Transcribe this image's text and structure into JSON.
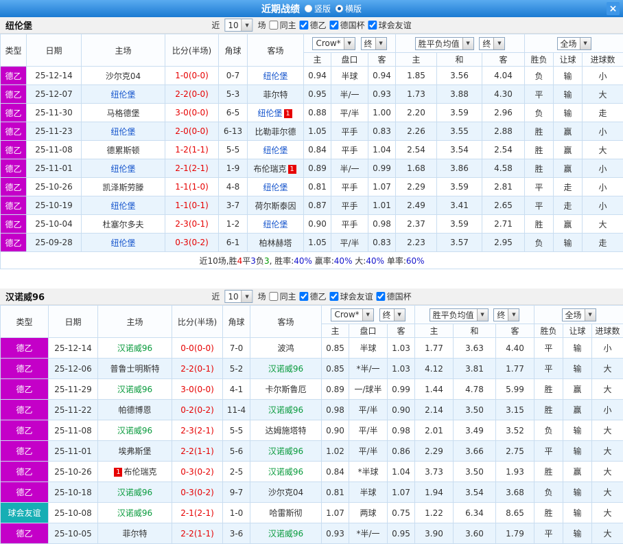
{
  "titlebar": {
    "title": "近期战绩",
    "radio_vertical": "竖版",
    "radio_horizontal": "横版",
    "selected_layout": "横版",
    "close_icon": "×"
  },
  "sections": [
    {
      "team": "纽伦堡",
      "team_color": "#1353cc",
      "filters": {
        "near_label": "近",
        "games_select": "10",
        "games_label": "场",
        "checkboxes": [
          {
            "label": "同主",
            "checked": false
          },
          {
            "label": "德乙",
            "checked": true
          },
          {
            "label": "德国杯",
            "checked": true
          },
          {
            "label": "球会友谊",
            "checked": true
          }
        ]
      },
      "header": {
        "type": "类型",
        "date": "日期",
        "home": "主场",
        "score": "比分(半场)",
        "corner": "角球",
        "away": "客场",
        "odds_company": "Crow*",
        "odds_stage": "终",
        "wdl_label": "胜平负均值",
        "wdl_stage": "终",
        "scope": "全场",
        "sub": [
          "主",
          "盘口",
          "客",
          "主",
          "和",
          "客",
          "胜负",
          "让球",
          "进球数"
        ]
      },
      "rows": [
        {
          "league": "德乙",
          "league_class": "de2",
          "date": "25-12-14",
          "home": "沙尔克04",
          "home_focus": false,
          "score": "1-0(0-0)",
          "corner": "0-7",
          "away": "纽伦堡",
          "away_focus": true,
          "asia": [
            "0.94",
            "半球",
            "0.94"
          ],
          "europe": [
            "1.85",
            "3.56",
            "4.04"
          ],
          "result": "负",
          "handicap": "输",
          "goals": "小"
        },
        {
          "league": "德乙",
          "league_class": "de2",
          "date": "25-12-07",
          "home": "纽伦堡",
          "home_focus": true,
          "score": "2-2(0-0)",
          "corner": "5-3",
          "away": "菲尔特",
          "away_focus": false,
          "asia": [
            "0.95",
            "半/一",
            "0.93"
          ],
          "europe": [
            "1.73",
            "3.88",
            "4.30"
          ],
          "result": "平",
          "handicap": "输",
          "goals": "大"
        },
        {
          "league": "德乙",
          "league_class": "de2",
          "date": "25-11-30",
          "home": "马格德堡",
          "home_focus": false,
          "score": "3-0(0-0)",
          "corner": "6-5",
          "away": "纽伦堡",
          "away_focus": true,
          "away_badge": "1",
          "asia": [
            "0.88",
            "平/半",
            "1.00"
          ],
          "europe": [
            "2.20",
            "3.59",
            "2.96"
          ],
          "result": "负",
          "handicap": "输",
          "goals": "走"
        },
        {
          "league": "德乙",
          "league_class": "de2",
          "date": "25-11-23",
          "home": "纽伦堡",
          "home_focus": true,
          "score": "2-0(0-0)",
          "corner": "6-13",
          "away": "比勒菲尔德",
          "away_focus": false,
          "asia": [
            "1.05",
            "平手",
            "0.83"
          ],
          "europe": [
            "2.26",
            "3.55",
            "2.88"
          ],
          "result": "胜",
          "handicap": "赢",
          "goals": "小"
        },
        {
          "league": "德乙",
          "league_class": "de2",
          "date": "25-11-08",
          "home": "德累斯顿",
          "home_focus": false,
          "score": "1-2(1-1)",
          "corner": "5-5",
          "away": "纽伦堡",
          "away_focus": true,
          "asia": [
            "0.84",
            "平手",
            "1.04"
          ],
          "europe": [
            "2.54",
            "3.54",
            "2.54"
          ],
          "result": "胜",
          "handicap": "赢",
          "goals": "大"
        },
        {
          "league": "德乙",
          "league_class": "de2",
          "date": "25-11-01",
          "home": "纽伦堡",
          "home_focus": true,
          "score": "2-1(2-1)",
          "corner": "1-9",
          "away": "布伦瑞克",
          "away_focus": false,
          "away_badge": "1",
          "asia": [
            "0.89",
            "半/一",
            "0.99"
          ],
          "europe": [
            "1.68",
            "3.86",
            "4.58"
          ],
          "result": "胜",
          "handicap": "赢",
          "goals": "小"
        },
        {
          "league": "德乙",
          "league_class": "de2",
          "date": "25-10-26",
          "home": "凯泽斯劳滕",
          "home_focus": false,
          "score": "1-1(1-0)",
          "corner": "4-8",
          "away": "纽伦堡",
          "away_focus": true,
          "asia": [
            "0.81",
            "平手",
            "1.07"
          ],
          "europe": [
            "2.29",
            "3.59",
            "2.81"
          ],
          "result": "平",
          "handicap": "走",
          "goals": "小"
        },
        {
          "league": "德乙",
          "league_class": "de2",
          "date": "25-10-19",
          "home": "纽伦堡",
          "home_focus": true,
          "score": "1-1(0-1)",
          "corner": "3-7",
          "away": "荷尔斯泰因",
          "away_focus": false,
          "asia": [
            "0.87",
            "平手",
            "1.01"
          ],
          "europe": [
            "2.49",
            "3.41",
            "2.65"
          ],
          "result": "平",
          "handicap": "走",
          "goals": "小"
        },
        {
          "league": "德乙",
          "league_class": "de2",
          "date": "25-10-04",
          "home": "杜塞尔多夫",
          "home_focus": false,
          "score": "2-3(0-1)",
          "corner": "1-2",
          "away": "纽伦堡",
          "away_focus": true,
          "asia": [
            "0.90",
            "平手",
            "0.98"
          ],
          "europe": [
            "2.37",
            "3.59",
            "2.71"
          ],
          "result": "胜",
          "handicap": "赢",
          "goals": "大"
        },
        {
          "league": "德乙",
          "league_class": "de2",
          "date": "25-09-28",
          "home": "纽伦堡",
          "home_focus": true,
          "score": "0-3(0-2)",
          "corner": "6-1",
          "away": "柏林赫塔",
          "away_focus": false,
          "asia": [
            "1.05",
            "平/半",
            "0.83"
          ],
          "europe": [
            "2.23",
            "3.57",
            "2.95"
          ],
          "result": "负",
          "handicap": "输",
          "goals": "走"
        }
      ],
      "summary_segments": [
        {
          "t": "近10场,胜",
          "c": "#333333"
        },
        {
          "t": "4",
          "c": "#e60000"
        },
        {
          "t": "平",
          "c": "#333333"
        },
        {
          "t": "3",
          "c": "#1414cc"
        },
        {
          "t": "负",
          "c": "#333333"
        },
        {
          "t": "3",
          "c": "#009900"
        },
        {
          "t": ", 胜率:",
          "c": "#333333"
        },
        {
          "t": "40%",
          "c": "#1414cc"
        },
        {
          "t": " 赢率:",
          "c": "#333333"
        },
        {
          "t": "40%",
          "c": "#1414cc"
        },
        {
          "t": " 大:",
          "c": "#333333"
        },
        {
          "t": "40%",
          "c": "#1414cc"
        },
        {
          "t": " 单率:",
          "c": "#333333"
        },
        {
          "t": "60%",
          "c": "#1414cc"
        }
      ]
    },
    {
      "team": "汉诺威96",
      "team_color": "#089a3c",
      "filters": {
        "near_label": "近",
        "games_select": "10",
        "games_label": "场",
        "checkboxes": [
          {
            "label": "同主",
            "checked": false
          },
          {
            "label": "德乙",
            "checked": true
          },
          {
            "label": "球会友谊",
            "checked": true
          },
          {
            "label": "德国杯",
            "checked": true
          }
        ]
      },
      "header": {
        "type": "类型",
        "date": "日期",
        "home": "主场",
        "score": "比分(半场)",
        "corner": "角球",
        "away": "客场",
        "odds_company": "Crow*",
        "odds_stage": "终",
        "wdl_label": "胜平负均值",
        "wdl_stage": "终",
        "scope": "全场",
        "sub": [
          "主",
          "盘口",
          "客",
          "主",
          "和",
          "客",
          "胜负",
          "让球",
          "进球数"
        ]
      },
      "rows": [
        {
          "league": "德乙",
          "league_class": "de2",
          "date": "25-12-14",
          "home": "汉诺威96",
          "home_focus": true,
          "score": "0-0(0-0)",
          "corner": "7-0",
          "away": "波鸿",
          "away_focus": false,
          "asia": [
            "0.85",
            "半球",
            "1.03"
          ],
          "europe": [
            "1.77",
            "3.63",
            "4.40"
          ],
          "result": "平",
          "handicap": "输",
          "goals": "小"
        },
        {
          "league": "德乙",
          "league_class": "de2",
          "date": "25-12-06",
          "home": "普鲁士明斯特",
          "home_focus": false,
          "score": "2-2(0-1)",
          "corner": "5-2",
          "away": "汉诺威96",
          "away_focus": true,
          "asia": [
            "0.85",
            "*半/一",
            "1.03"
          ],
          "europe": [
            "4.12",
            "3.81",
            "1.77"
          ],
          "result": "平",
          "handicap": "输",
          "goals": "大"
        },
        {
          "league": "德乙",
          "league_class": "de2",
          "date": "25-11-29",
          "home": "汉诺威96",
          "home_focus": true,
          "score": "3-0(0-0)",
          "corner": "4-1",
          "away": "卡尔斯鲁厄",
          "away_focus": false,
          "asia": [
            "0.89",
            "一/球半",
            "0.99"
          ],
          "europe": [
            "1.44",
            "4.78",
            "5.99"
          ],
          "result": "胜",
          "handicap": "赢",
          "goals": "大"
        },
        {
          "league": "德乙",
          "league_class": "de2",
          "date": "25-11-22",
          "home": "帕德博恩",
          "home_focus": false,
          "score": "0-2(0-2)",
          "corner": "11-4",
          "away": "汉诺威96",
          "away_focus": true,
          "asia": [
            "0.98",
            "平/半",
            "0.90"
          ],
          "europe": [
            "2.14",
            "3.50",
            "3.15"
          ],
          "result": "胜",
          "handicap": "赢",
          "goals": "小"
        },
        {
          "league": "德乙",
          "league_class": "de2",
          "date": "25-11-08",
          "home": "汉诺威96",
          "home_focus": true,
          "score": "2-3(2-1)",
          "corner": "5-5",
          "away": "达姆施塔特",
          "away_focus": false,
          "asia": [
            "0.90",
            "平/半",
            "0.98"
          ],
          "europe": [
            "2.01",
            "3.49",
            "3.52"
          ],
          "result": "负",
          "handicap": "输",
          "goals": "大"
        },
        {
          "league": "德乙",
          "league_class": "de2",
          "date": "25-11-01",
          "home": "埃弗斯堡",
          "home_focus": false,
          "score": "2-2(1-1)",
          "corner": "5-6",
          "away": "汉诺威96",
          "away_focus": true,
          "asia": [
            "1.02",
            "平/半",
            "0.86"
          ],
          "europe": [
            "2.29",
            "3.66",
            "2.75"
          ],
          "result": "平",
          "handicap": "输",
          "goals": "大"
        },
        {
          "league": "德乙",
          "league_class": "de2",
          "date": "25-10-26",
          "home": "布伦瑞克",
          "home_focus": false,
          "home_badge": "1",
          "home_badge_before": true,
          "score": "0-3(0-2)",
          "corner": "2-5",
          "away": "汉诺威96",
          "away_focus": true,
          "asia": [
            "0.84",
            "*半球",
            "1.04"
          ],
          "europe": [
            "3.73",
            "3.50",
            "1.93"
          ],
          "result": "胜",
          "handicap": "赢",
          "goals": "大"
        },
        {
          "league": "德乙",
          "league_class": "de2",
          "date": "25-10-18",
          "home": "汉诺威96",
          "home_focus": true,
          "score": "0-3(0-2)",
          "corner": "9-7",
          "away": "沙尔克04",
          "away_focus": false,
          "asia": [
            "0.81",
            "半球",
            "1.07"
          ],
          "europe": [
            "1.94",
            "3.54",
            "3.68"
          ],
          "result": "负",
          "handicap": "输",
          "goals": "大"
        },
        {
          "league": "球会友谊",
          "league_class": "friendly",
          "date": "25-10-08",
          "home": "汉诺威96",
          "home_focus": true,
          "score": "2-1(2-1)",
          "corner": "1-0",
          "away": "哈雷斯彻",
          "away_focus": false,
          "asia": [
            "1.07",
            "两球",
            "0.75"
          ],
          "europe": [
            "1.22",
            "6.34",
            "8.65"
          ],
          "result": "胜",
          "handicap": "输",
          "goals": "大"
        },
        {
          "league": "德乙",
          "league_class": "de2",
          "date": "25-10-05",
          "home": "菲尔特",
          "home_focus": false,
          "score": "2-2(1-1)",
          "corner": "3-6",
          "away": "汉诺威96",
          "away_focus": true,
          "asia": [
            "0.93",
            "*半/一",
            "0.95"
          ],
          "europe": [
            "3.90",
            "3.60",
            "1.79"
          ],
          "result": "平",
          "handicap": "输",
          "goals": "大"
        }
      ]
    }
  ]
}
